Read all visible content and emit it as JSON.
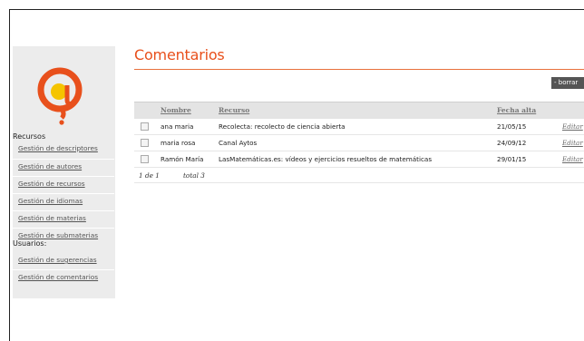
{
  "sidebar": {
    "logo": "at-sign-question-logo",
    "sections": [
      {
        "heading": "Recursos",
        "items": [
          {
            "label": "Gestión de descriptores"
          },
          {
            "label": "Gestión de autores"
          },
          {
            "label": "Gestión de recursos"
          },
          {
            "label": "Gestión de idiomas"
          },
          {
            "label": "Gestión de materias"
          },
          {
            "label": "Gestión de submaterias"
          }
        ]
      },
      {
        "heading": "Usuarios:",
        "items": [
          {
            "label": "Gestión de sugerencias"
          },
          {
            "label": "Gestión de comentarios"
          }
        ]
      }
    ]
  },
  "main": {
    "title": "Comentarios",
    "borrar_label": "- borrar",
    "columns": [
      "Nombre",
      "Recurso",
      "Fecha alta"
    ],
    "rows": [
      {
        "nombre": "ana maria",
        "recurso": "Recolecta: recolecto de ciencia abierta",
        "fecha": "21/05/15",
        "action": "Editar"
      },
      {
        "nombre": "maria rosa",
        "recurso": "Canal Aytos",
        "fecha": "24/09/12",
        "action": "Editar"
      },
      {
        "nombre": "Ramón María",
        "recurso": "LasMatemáticas.es: vídeos y ejercicios resueltos de matemáticas",
        "fecha": "29/01/15",
        "action": "Editar"
      }
    ],
    "pager": {
      "page": "1 de 1",
      "total": "total 3"
    }
  },
  "colors": {
    "accent": "#e8501c",
    "logo_orange": "#e8501c",
    "logo_yellow": "#f5c400",
    "sidebar_bg": "#ececec"
  }
}
